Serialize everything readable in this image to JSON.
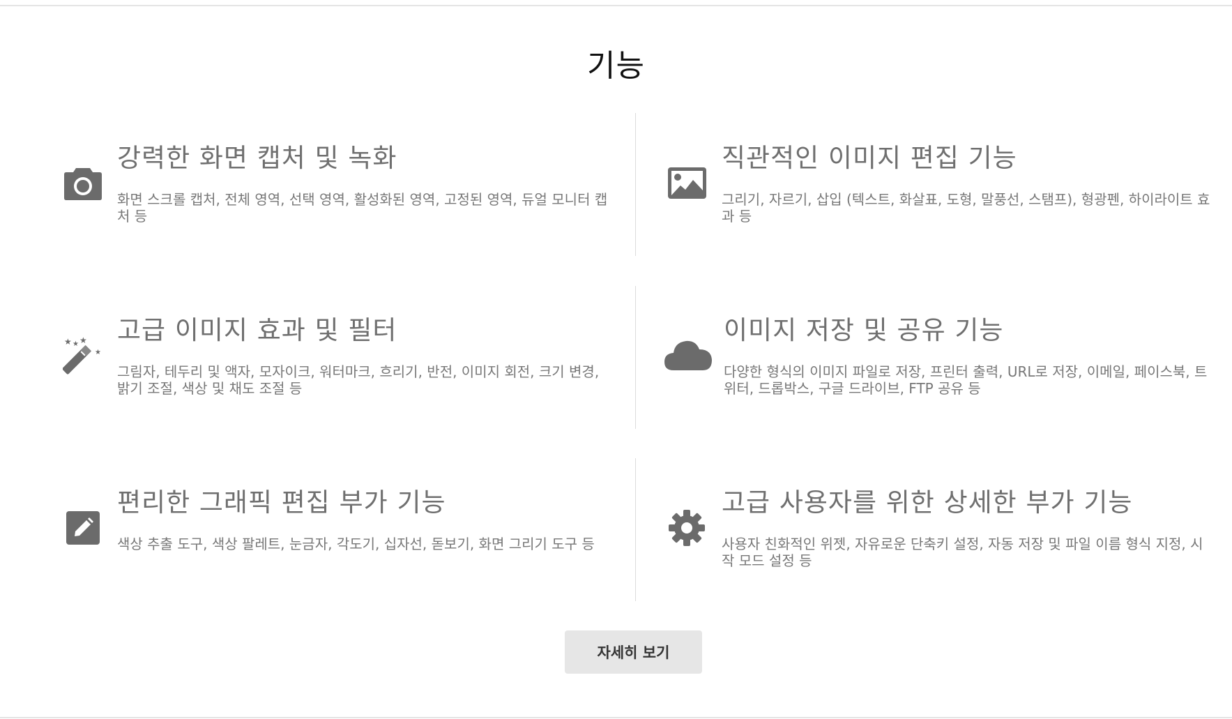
{
  "section": {
    "title": "기능"
  },
  "features": [
    {
      "icon": "camera-icon",
      "title": "강력한 화면 캡처 및 녹화",
      "description": "화면 스크롤 캡처, 전체 영역, 선택 영역, 활성화된 영역, 고정된 영역, 듀얼 모니터 캡처 등"
    },
    {
      "icon": "image-icon",
      "title": "직관적인 이미지 편집 기능",
      "description": "그리기, 자르기, 삽입 (텍스트, 화살표, 도형, 말풍선, 스탬프), 형광펜, 하이라이트 효과 등"
    },
    {
      "icon": "magic-wand-icon",
      "title": "고급 이미지 효과 및 필터",
      "description": "그림자, 테두리 및 액자, 모자이크, 워터마크, 흐리기, 반전, 이미지 회전, 크기 변경, 밝기 조절, 색상 및 채도 조절 등"
    },
    {
      "icon": "cloud-icon",
      "title": "이미지 저장 및 공유 기능",
      "description": "다양한 형식의 이미지 파일로 저장, 프린터 출력, URL로 저장, 이메일, 페이스북, 트위터, 드롭박스, 구글 드라이브, FTP 공유 등"
    },
    {
      "icon": "pencil-icon",
      "title": "편리한 그래픽 편집 부가 기능",
      "description": "색상 추출 도구, 색상 팔레트, 눈금자, 각도기, 십자선, 돋보기, 화면 그리기 도구 등"
    },
    {
      "icon": "gear-icon",
      "title": "고급 사용자를 위한 상세한 부가 기능",
      "description": "사용자 친화적인 위젯, 자유로운 단축키 설정, 자동 저장 및 파일 이름 형식 지정, 시작 모드 설정 등"
    }
  ],
  "more_button": {
    "label": "자세히 보기"
  },
  "colors": {
    "icon": "#6b6b6b",
    "button_bg": "#e6e6e6",
    "divider": "#dcdcdc"
  }
}
